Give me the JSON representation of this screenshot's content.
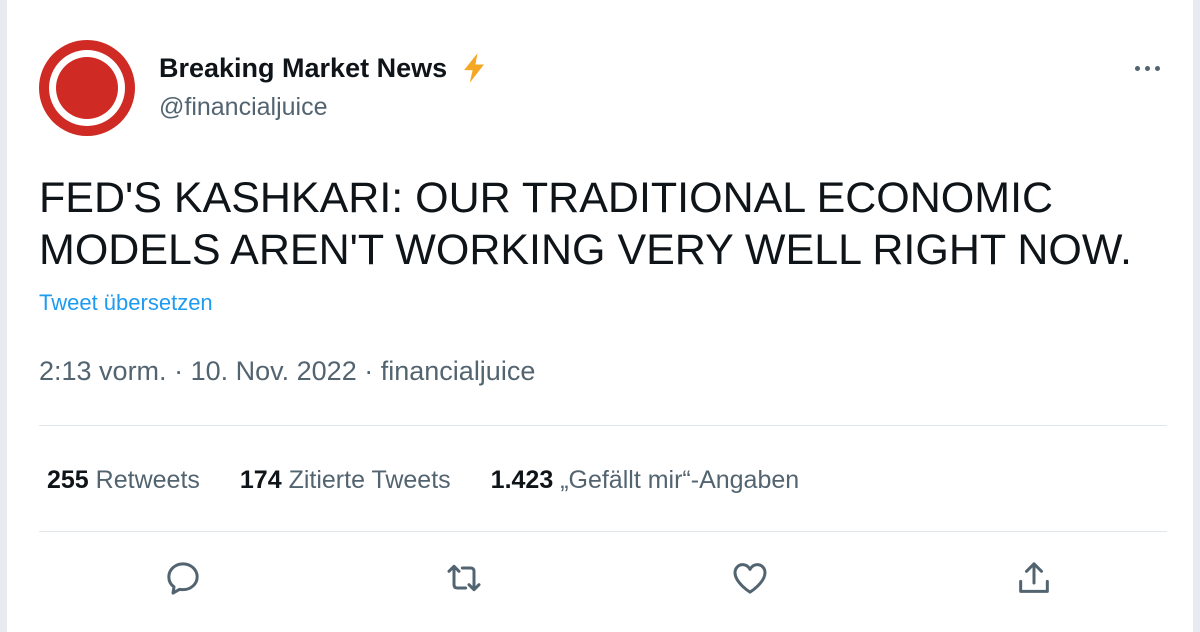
{
  "author": {
    "display_name": "Breaking Market News",
    "handle": "@financialjuice",
    "badge_icon": "lightning-bolt-icon",
    "avatar_colors": {
      "outer": "#cf2a23",
      "ring": "#ffffff",
      "core": "#cf2a23"
    }
  },
  "tweet": {
    "text_line1": "FED'S KASHKARI: OUR TRADITIONAL ECONOMIC",
    "text_line2": "MODELS AREN'T WORKING VERY WELL RIGHT NOW.",
    "translate_label": "Tweet übersetzen",
    "time": "2:13 vorm.",
    "separator": "·",
    "date": "10. Nov. 2022",
    "source": "financialjuice"
  },
  "stats": {
    "retweets": {
      "count": "255",
      "label": "Retweets"
    },
    "quotes": {
      "count": "174",
      "label": "Zitierte Tweets"
    },
    "likes": {
      "count": "1.423",
      "label": "„Gefällt mir“-Angaben"
    }
  },
  "actions": [
    "reply-icon",
    "retweet-icon",
    "like-icon",
    "share-icon"
  ],
  "colors": {
    "text_primary": "#0f1419",
    "text_secondary": "#536471",
    "link": "#1d9bf0",
    "divider": "#e1e6ea",
    "bolt": "#f5a623"
  }
}
